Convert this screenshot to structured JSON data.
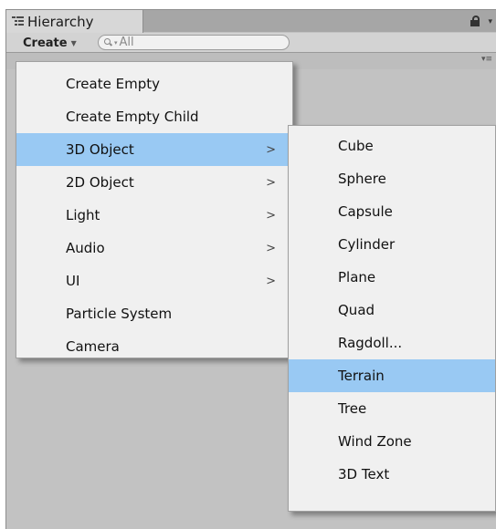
{
  "window": {
    "tab_title": "Hierarchy"
  },
  "toolbar": {
    "create_label": "Create",
    "search_placeholder": "All"
  },
  "main_menu": {
    "items": [
      {
        "label": "Create Empty",
        "has_submenu": false,
        "highlighted": false
      },
      {
        "label": "Create Empty Child",
        "has_submenu": false,
        "highlighted": false
      },
      {
        "label": "3D Object",
        "has_submenu": true,
        "highlighted": true
      },
      {
        "label": "2D Object",
        "has_submenu": true,
        "highlighted": false
      },
      {
        "label": "Light",
        "has_submenu": true,
        "highlighted": false
      },
      {
        "label": "Audio",
        "has_submenu": true,
        "highlighted": false
      },
      {
        "label": "UI",
        "has_submenu": true,
        "highlighted": false
      },
      {
        "label": "Particle System",
        "has_submenu": false,
        "highlighted": false
      },
      {
        "label": "Camera",
        "has_submenu": false,
        "highlighted": false
      }
    ],
    "submenu_arrow": ">"
  },
  "sub_menu": {
    "items": [
      {
        "label": "Cube",
        "highlighted": false
      },
      {
        "label": "Sphere",
        "highlighted": false
      },
      {
        "label": "Capsule",
        "highlighted": false
      },
      {
        "label": "Cylinder",
        "highlighted": false
      },
      {
        "label": "Plane",
        "highlighted": false
      },
      {
        "label": "Quad",
        "highlighted": false
      },
      {
        "label": "Ragdoll...",
        "highlighted": false
      },
      {
        "label": "Terrain",
        "highlighted": true
      },
      {
        "label": "Tree",
        "highlighted": false
      },
      {
        "label": "Wind Zone",
        "highlighted": false
      },
      {
        "label": "3D Text",
        "highlighted": false
      }
    ]
  },
  "colors": {
    "highlight": "#99c9f3",
    "menu_background": "#f0f0f0",
    "panel_background": "#c2c2c2"
  },
  "icons": {
    "tab_icon": "hierarchy-list-icon",
    "lock": "lock-icon",
    "search": "search-icon"
  }
}
